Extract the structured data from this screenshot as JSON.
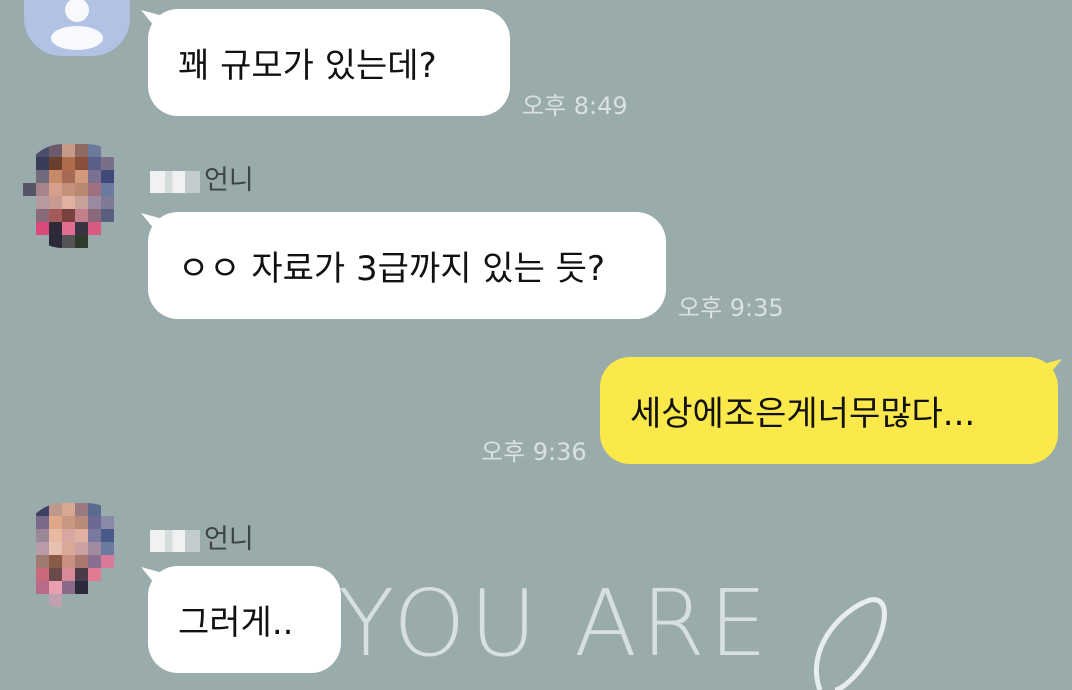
{
  "background": {
    "text": "YOU ARE",
    "color": "#9aabab"
  },
  "messages": [
    {
      "sender": "",
      "text": "꽤 규모가 있는데?",
      "time": "오후 8:49"
    },
    {
      "sender": "언니",
      "text": "ㅇㅇ 자료가 3급까지 있는 듯?",
      "time": "오후 9:35"
    },
    {
      "sender": "me",
      "text": "세상에조은게너무많다...",
      "time": "오후 9:36"
    },
    {
      "sender": "언니",
      "text": "그러게..",
      "time": ""
    }
  ],
  "colors": {
    "incoming_bubble": "#ffffff",
    "outgoing_bubble": "#fbe84a"
  }
}
